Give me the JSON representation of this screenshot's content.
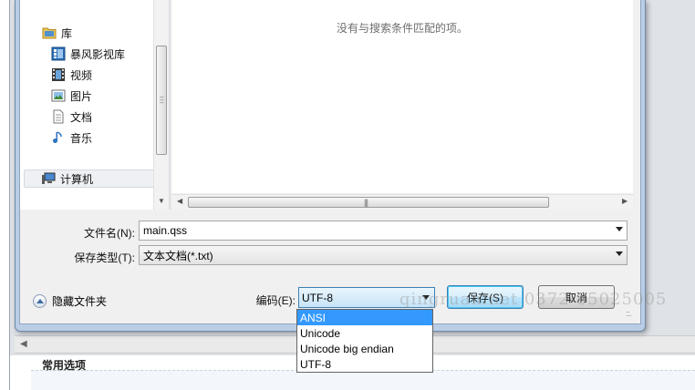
{
  "nav": {
    "library_label": "库",
    "items": [
      {
        "label": "暴风影视库",
        "icon": "media-library-icon"
      },
      {
        "label": "视频",
        "icon": "video-icon"
      },
      {
        "label": "图片",
        "icon": "picture-icon"
      },
      {
        "label": "文档",
        "icon": "document-icon"
      },
      {
        "label": "音乐",
        "icon": "music-icon"
      }
    ],
    "computer_label": "计算机"
  },
  "file_list": {
    "empty_message": "没有与搜索条件匹配的项。"
  },
  "form": {
    "filename_label": "文件名(N):",
    "filename_value": "main.qss",
    "filetype_label": "保存类型(T):",
    "filetype_value": "文本文档(*.txt)",
    "encoding_label": "编码(E):",
    "encoding_value": "UTF-8",
    "encoding_options": [
      "ANSI",
      "Unicode",
      "Unicode big endian",
      "UTF-8"
    ],
    "encoding_highlighted": "ANSI"
  },
  "buttons": {
    "hide_folders": "隐藏文件夹",
    "save": "保存(S)",
    "cancel": "取消"
  },
  "background": {
    "section_title": "常用选项"
  },
  "watermark": "qingruan.net 0372-85025005"
}
